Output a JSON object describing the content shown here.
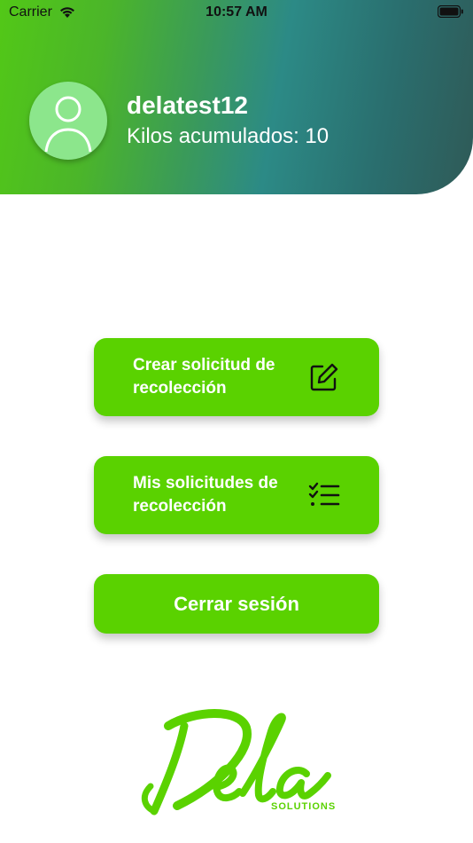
{
  "status_bar": {
    "carrier": "Carrier",
    "time": "10:57 AM",
    "wifi_icon": "wifi-icon",
    "battery_icon": "battery-icon"
  },
  "profile": {
    "avatar_icon": "user-icon",
    "username": "delatest12",
    "kilos_text": "Kilos acumulados: 10"
  },
  "actions": {
    "create_request": {
      "label": "Crear solicitud de recolección",
      "icon": "edit-icon"
    },
    "my_requests": {
      "label": "Mis solicitudes de recolección",
      "icon": "checklist-icon"
    },
    "logout": {
      "label": "Cerrar sesión"
    }
  },
  "logo": {
    "brand": "Dela",
    "tagline": "SOLUTIONS"
  },
  "colors": {
    "primary_green": "#5ad200",
    "header_start": "#52c817",
    "header_end": "#2f5a57",
    "avatar_bg": "#8ce68c"
  }
}
